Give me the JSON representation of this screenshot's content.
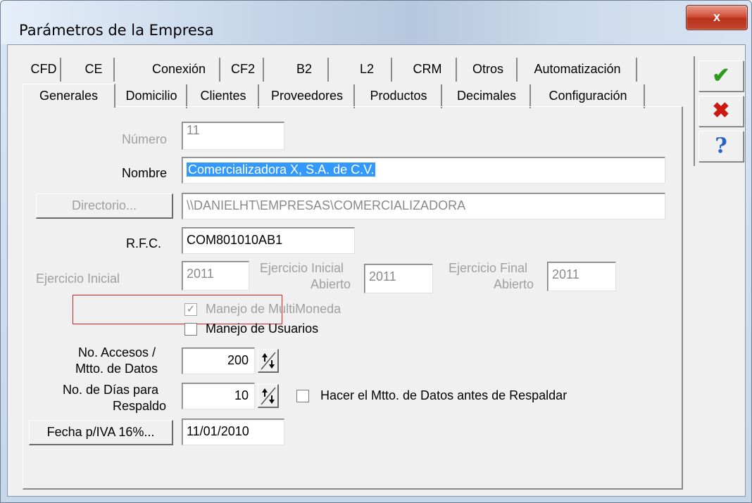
{
  "window": {
    "title": "Parámetros de la Empresa",
    "close_label": "x"
  },
  "tabs_row1": [
    "CFD",
    "CE",
    "Conexión",
    "CF2",
    "B2",
    "L2",
    "CRM",
    "Otros",
    "Automatización"
  ],
  "tabs_row2": [
    "Generales",
    "Domicilio",
    "Clientes",
    "Proveedores",
    "Productos",
    "Decimales",
    "Configuración"
  ],
  "active_tab": "Generales",
  "toolbar": {
    "ok_icon": "check-icon",
    "cancel_icon": "x-icon",
    "help_icon": "question-icon"
  },
  "form": {
    "numero_label": "Número",
    "numero_value": "11",
    "nombre_label": "Nombre",
    "nombre_value": "Comercializadora X, S.A. de C.V.",
    "directorio_button": "Directorio...",
    "directorio_value": "\\\\DANIELHT\\EMPRESAS\\COMERCIALIZADORA",
    "rfc_label": "R.F.C.",
    "rfc_value": "COM801010AB1",
    "ejercicio_inicial_label": "Ejercicio Inicial",
    "ejercicio_inicial_value": "2011",
    "ejercicio_inicial_abierto_label_1": "Ejercicio Inicial",
    "ejercicio_inicial_abierto_label_2": "Abierto",
    "ejercicio_inicial_abierto_value": "2011",
    "ejercicio_final_abierto_label_1": "Ejercicio Final",
    "ejercicio_final_abierto_label_2": "Abierto",
    "ejercicio_final_abierto_value": "2011",
    "multimoneda_label": "Manejo de MultiMoneda",
    "multimoneda_checked": true,
    "usuarios_label": "Manejo de Usuarios",
    "usuarios_checked": false,
    "accesos_label_1": "No. Accesos /",
    "accesos_label_2": "Mtto. de Datos",
    "accesos_value": "200",
    "dias_label_1": "No. de Días para",
    "dias_label_2": "Respaldo",
    "dias_value": "10",
    "mtto_antes_label": "Hacer el Mtto. de Datos antes de Respaldar",
    "mtto_antes_checked": false,
    "fecha_iva_button": "Fecha p/IVA 16%...",
    "fecha_iva_value": "11/01/2010"
  },
  "colors": {
    "selection": "#3399ff",
    "ok_green": "#2e9a1e",
    "cancel_red": "#cc1a12",
    "help_blue": "#2a62c8",
    "annotation_red": "#e02020"
  }
}
